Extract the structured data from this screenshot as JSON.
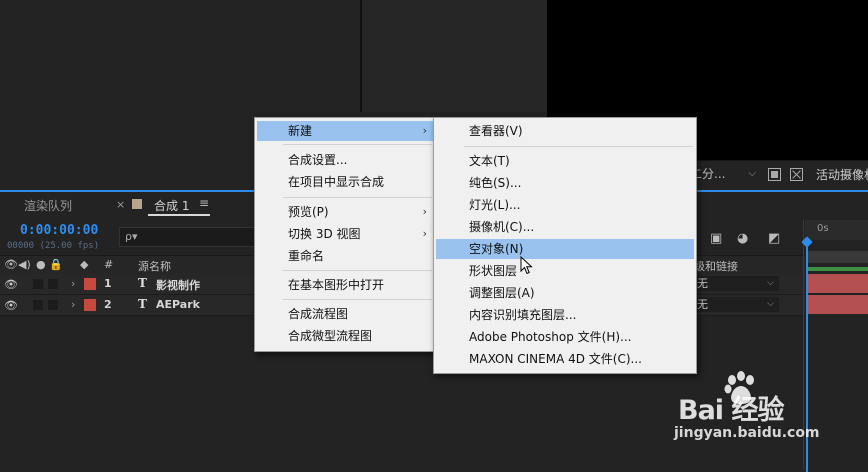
{
  "viewer_bar": {
    "dropdown_value": "二分...",
    "camera_label": "活动摄像机"
  },
  "timeline": {
    "tab_render": "渲染队列",
    "tab_close": "×",
    "tab_comp": "合成 1",
    "tab_menu": "≡",
    "timecode": "0:00:00:00",
    "fps": "00000 (25.00 fps)",
    "search_placeholder": "ρ▾",
    "ruler_label": "0s",
    "columns": {
      "hash": "#",
      "source_name": "源名称",
      "parent": "父级和链接"
    },
    "layers": [
      {
        "num": "1",
        "type_icon": "T",
        "name": "影视制作",
        "parent": "无"
      },
      {
        "num": "2",
        "type_icon": "T",
        "name": "AEPark",
        "parent": "无"
      }
    ],
    "label_color": "#c8493e",
    "accent_color": "#2d8ceb"
  },
  "context_menu": {
    "items": [
      {
        "label": "新建",
        "has_submenu": true,
        "highlighted": true
      },
      {
        "label": "合成设置..."
      },
      {
        "label": "在项目中显示合成"
      },
      {
        "label": "预览(P)",
        "has_submenu": true
      },
      {
        "label": "切换 3D 视图",
        "has_submenu": true
      },
      {
        "label": "重命名"
      },
      {
        "label": "在基本图形中打开"
      },
      {
        "label": "合成流程图"
      },
      {
        "label": "合成微型流程图"
      }
    ],
    "highlight_color": "#99c2ef"
  },
  "sub_menu": {
    "items": [
      {
        "label": "查看器(V)"
      },
      {
        "label": "文本(T)"
      },
      {
        "label": "纯色(S)..."
      },
      {
        "label": "灯光(L)..."
      },
      {
        "label": "摄像机(C)..."
      },
      {
        "label": "空对象(N)",
        "highlighted": true
      },
      {
        "label": "形状图层"
      },
      {
        "label": "调整图层(A)"
      },
      {
        "label": "内容识别填充图层..."
      },
      {
        "label": "Adobe Photoshop 文件(H)..."
      },
      {
        "label": "MAXON CINEMA 4D 文件(C)..."
      }
    ]
  },
  "watermark": {
    "brand": "Bai  经验",
    "url": "jingyan.baidu.com"
  }
}
